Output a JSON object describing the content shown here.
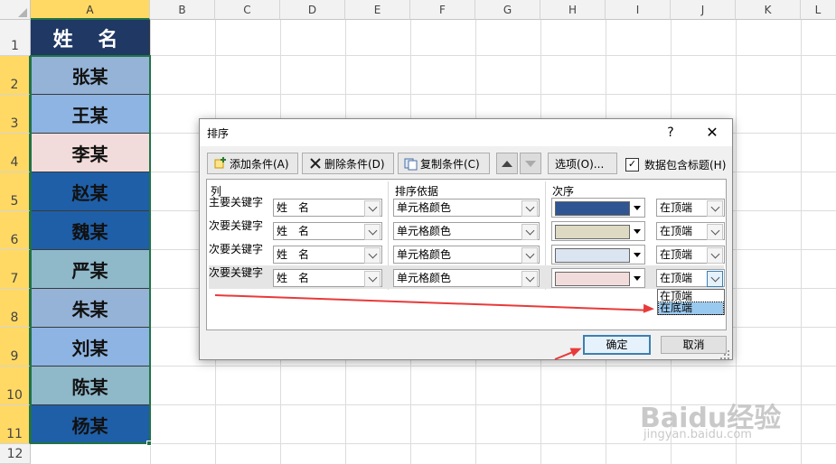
{
  "sheet": {
    "columns": [
      "A",
      "B",
      "C",
      "D",
      "E",
      "F",
      "G",
      "H",
      "I",
      "J",
      "K",
      "L"
    ],
    "rows": [
      "1",
      "2",
      "3",
      "4",
      "5",
      "6",
      "7",
      "8",
      "9",
      "10",
      "11",
      "12"
    ],
    "cells": [
      {
        "text": "姓 名",
        "fill": "#1f3864"
      },
      {
        "text": "张某",
        "fill": "#95b3d7"
      },
      {
        "text": "王某",
        "fill": "#8db4e2"
      },
      {
        "text": "李某",
        "fill": "#f2dcdb"
      },
      {
        "text": "赵某",
        "fill": "#1f5fa8"
      },
      {
        "text": "魏某",
        "fill": "#1f5fa8"
      },
      {
        "text": "严某",
        "fill": "#8fb8c9"
      },
      {
        "text": "朱某",
        "fill": "#95b3d7"
      },
      {
        "text": "刘某",
        "fill": "#8db4e2"
      },
      {
        "text": "陈某",
        "fill": "#8fb8c9"
      },
      {
        "text": "杨某",
        "fill": "#1f5fa8"
      }
    ]
  },
  "dialog": {
    "title": "排序",
    "help": "?",
    "close": "✕",
    "toolbar": {
      "add": "添加条件(A)",
      "delete": "删除条件(D)",
      "copy": "复制条件(C)",
      "options": "选项(O)...",
      "header_checkbox": "数据包含标题(H)",
      "header_checked": "✓"
    },
    "list_headers": {
      "column": "列",
      "basis": "排序依据",
      "order": "次序"
    },
    "levels": [
      {
        "label": "主要关键字",
        "column": "姓　名",
        "basis": "单元格颜色",
        "color": "#2f5592",
        "position": "在顶端"
      },
      {
        "label": "次要关键字",
        "column": "姓　名",
        "basis": "单元格颜色",
        "color": "#ddd9c3",
        "position": "在顶端"
      },
      {
        "label": "次要关键字",
        "column": "姓　名",
        "basis": "单元格颜色",
        "color": "#dbe5f1",
        "position": "在顶端"
      },
      {
        "label": "次要关键字",
        "column": "姓　名",
        "basis": "单元格颜色",
        "color": "#f2dcdb",
        "position": "在顶端"
      }
    ],
    "position_options": [
      "在顶端",
      "在底端"
    ],
    "position_highlighted": "在底端",
    "ok": "确定",
    "cancel": "取消"
  },
  "watermark": {
    "brand": "Baidu经验",
    "url": "jingyan.baidu.com"
  },
  "annotation_color": "#e83a3a"
}
